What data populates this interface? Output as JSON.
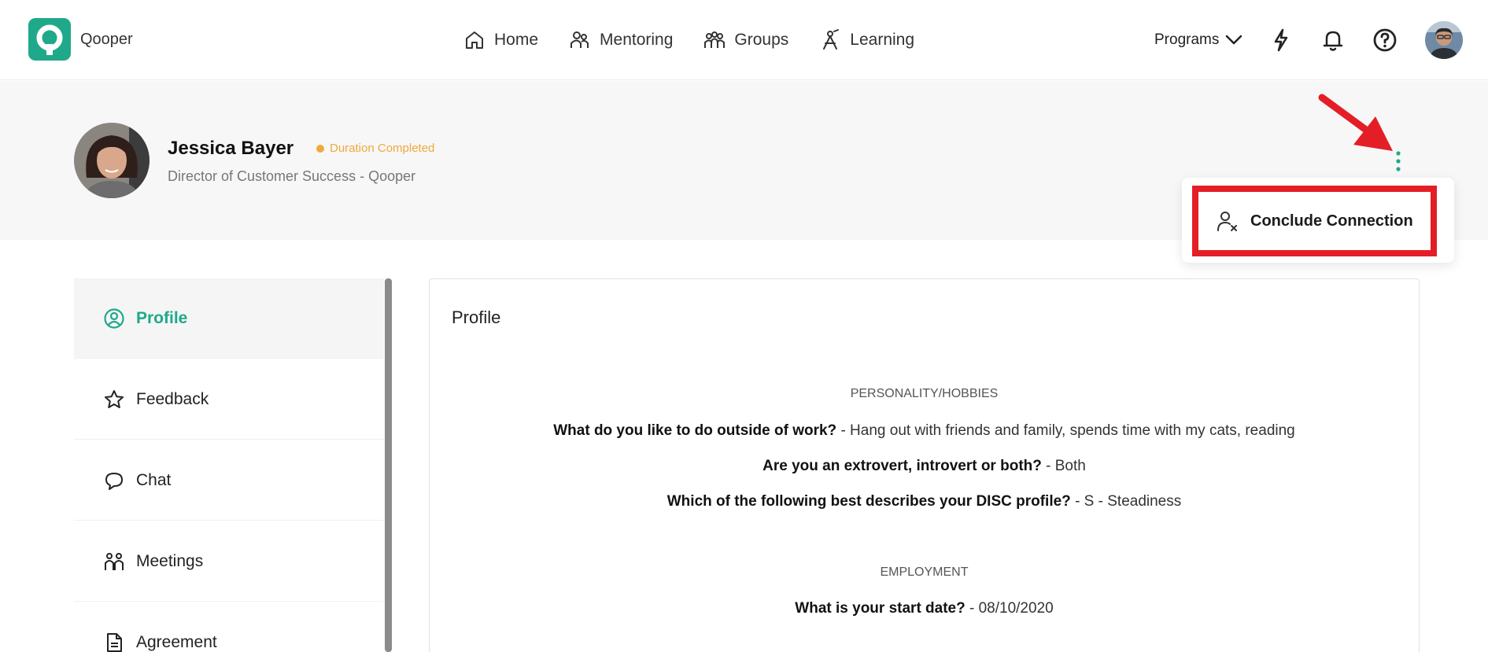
{
  "app": {
    "brand": "Qooper"
  },
  "nav": {
    "items": [
      {
        "label": "Home",
        "icon": "home-icon"
      },
      {
        "label": "Mentoring",
        "icon": "mentoring-icon"
      },
      {
        "label": "Groups",
        "icon": "groups-icon"
      },
      {
        "label": "Learning",
        "icon": "learning-icon"
      }
    ],
    "programs_label": "Programs"
  },
  "connection": {
    "name": "Jessica Bayer",
    "status": "Duration Completed",
    "title": "Director of Customer Success - Qooper",
    "menu_item": "Conclude Connection"
  },
  "sidebar": {
    "items": [
      {
        "label": "Profile",
        "icon": "profile-icon"
      },
      {
        "label": "Feedback",
        "icon": "star-icon"
      },
      {
        "label": "Chat",
        "icon": "chat-icon"
      },
      {
        "label": "Meetings",
        "icon": "meetings-icon"
      },
      {
        "label": "Agreement",
        "icon": "document-icon"
      }
    ]
  },
  "profile": {
    "title": "Profile",
    "sections": [
      {
        "heading": "PERSONALITY/HOBBIES",
        "qa": [
          {
            "q": "What do you like to do outside of work?",
            "a": " - Hang out with friends and family, spends time with my cats, reading"
          },
          {
            "q": "Are you an extrovert, introvert or both?",
            "a": " - Both"
          },
          {
            "q": "Which of the following best describes your DISC profile?",
            "a": " - S - Steadiness"
          }
        ]
      },
      {
        "heading": "EMPLOYMENT",
        "qa": [
          {
            "q": "What is your start date?",
            "a": " - 08/10/2020"
          }
        ]
      }
    ]
  },
  "colors": {
    "accent": "#1fa98a",
    "status": "#f0a93a",
    "highlight": "#e41e26"
  }
}
